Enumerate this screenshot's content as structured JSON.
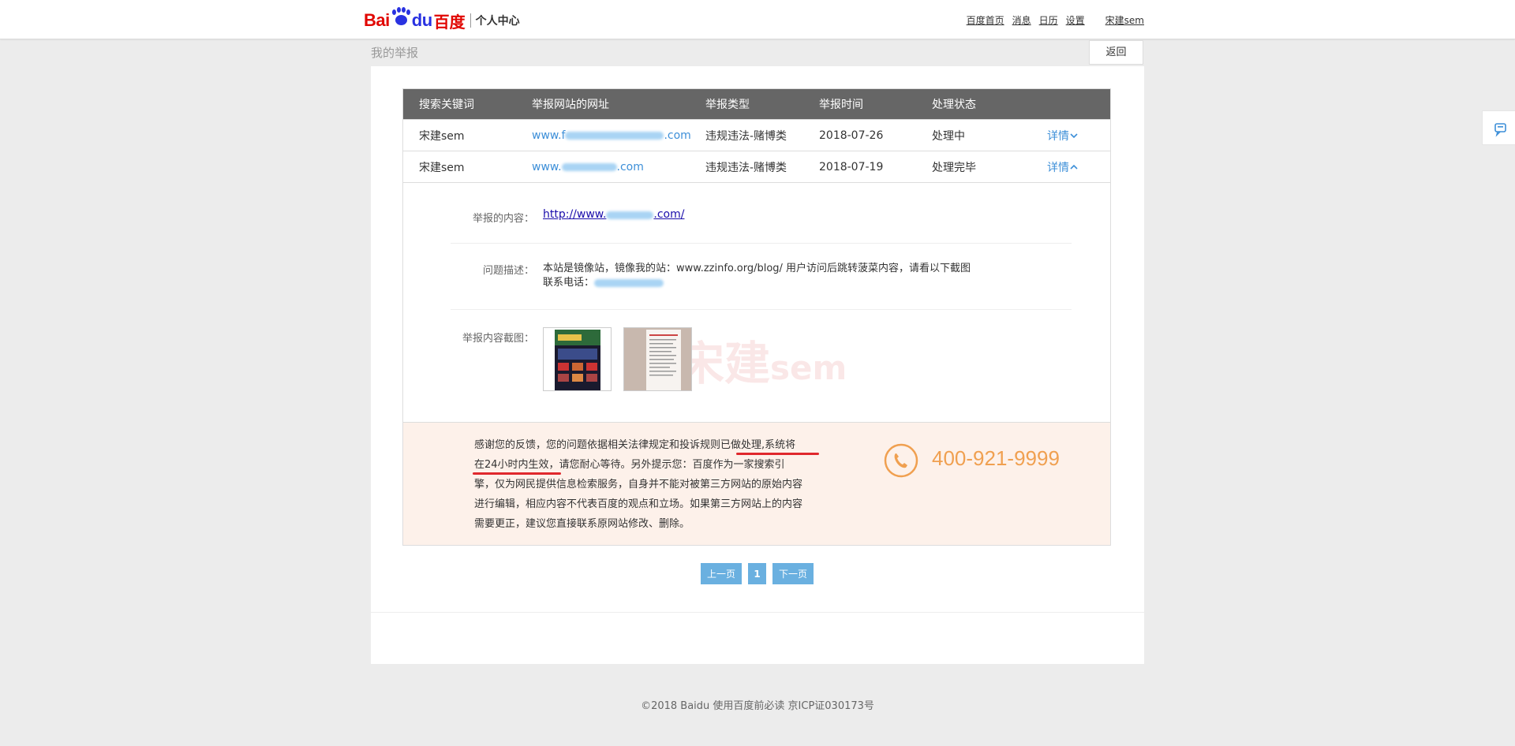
{
  "header": {
    "logo_bai": "Bai",
    "logo_du": "du",
    "logo_cn": "百度",
    "subtitle": "个人中心",
    "nav": [
      "百度首页",
      "消息",
      "日历",
      "设置",
      "宋建sem"
    ]
  },
  "page": {
    "title": "我的举报",
    "back_label": "返回"
  },
  "table": {
    "columns": [
      "搜索关键词",
      "举报网站的网址",
      "举报类型",
      "举报时间",
      "处理状态"
    ],
    "rows": [
      {
        "keyword": "宋建sem",
        "url_prefix": "www.f",
        "url_suffix": ".com",
        "type": "违规违法-赌博类",
        "date": "2018-07-26",
        "status": "处理中",
        "detail": "详情",
        "detail_icon": "chevron-down-icon"
      },
      {
        "keyword": "宋建sem",
        "url_prefix": "www.",
        "url_suffix": ".com",
        "type": "违规违法-赌博类",
        "date": "2018-07-19",
        "status": "处理完毕",
        "detail": "详情",
        "detail_icon": "chevron-up-icon"
      }
    ]
  },
  "detail": {
    "content_label": "举报的内容：",
    "content_prefix": "http://www.",
    "content_suffix": ".com/",
    "desc_label": "问题描述：",
    "desc_line1": "本站是镜像站，镜像我的站：www.zzinfo.org/blog/ 用户访问后跳转菠菜内容，请看以下截图",
    "desc_line2_label": "联系电话：",
    "screenshot_label": "举报内容截图："
  },
  "notice": {
    "part1": "感谢您的反馈，您的问题依据相关法律规定和投诉规则已做处理,系统将",
    "part2": "在24小时内生效，请您耐心等待。另外提示您：百度作为一家搜索引",
    "part3": "擎，仅为网民提供信息检索服务，自身并不能对被第三方网站的原始内容",
    "part4": "进行编辑，相应内容不代表百度的观点和立场。如果第三方网站上的内容",
    "part5": "需要更正，建议您直接联系原网站修改、删除。",
    "phone": "400-921-9999"
  },
  "pager": {
    "prev": "上一页",
    "current": "1",
    "next": "下一页"
  },
  "watermark": {
    "text": "宋建",
    "small": "sem"
  },
  "footer": {
    "text": "©2018 Baidu 使用百度前必读 京ICP证030173号"
  },
  "colors": {
    "accent": "#3d8fd8",
    "table_header": "#666666",
    "notice_bg": "#fdf1ea",
    "phone": "#f0a050",
    "pager": "#6ab0e0"
  }
}
